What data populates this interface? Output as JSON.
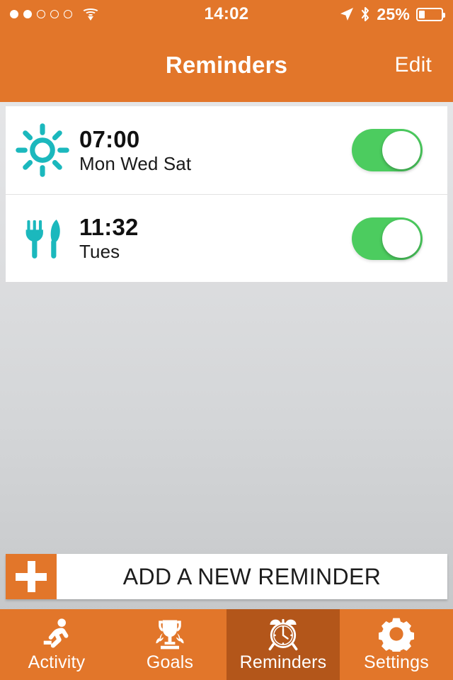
{
  "status_bar": {
    "signal_dots_total": 5,
    "signal_dots_filled": 2,
    "wifi_icon": "wifi-icon",
    "time": "14:02",
    "location_icon": "location-arrow-icon",
    "bluetooth_icon": "bluetooth-icon",
    "battery_percent_label": "25%",
    "battery_level": 25
  },
  "nav": {
    "title": "Reminders",
    "edit_label": "Edit"
  },
  "reminders": [
    {
      "icon": "sun-icon",
      "time": "07:00",
      "days": "Mon Wed Sat",
      "enabled": true
    },
    {
      "icon": "cutlery-icon",
      "time": "11:32",
      "days": "Tues",
      "enabled": true
    }
  ],
  "add_button": {
    "label": "ADD A NEW REMINDER",
    "icon": "plus-icon"
  },
  "tabbar": {
    "active_index": 2,
    "items": [
      {
        "label": "Activity",
        "icon": "running-person-icon"
      },
      {
        "label": "Goals",
        "icon": "trophy-icon"
      },
      {
        "label": "Reminders",
        "icon": "alarm-clock-icon"
      },
      {
        "label": "Settings",
        "icon": "gear-icon"
      }
    ]
  },
  "colors": {
    "brand_orange": "#e2762a",
    "active_tab_orange": "#b3561a",
    "toggle_green": "#4ccc5f",
    "icon_teal": "#1bb8bd",
    "background_top": "#e8e9ea",
    "background_bottom": "#c2c4c6"
  }
}
